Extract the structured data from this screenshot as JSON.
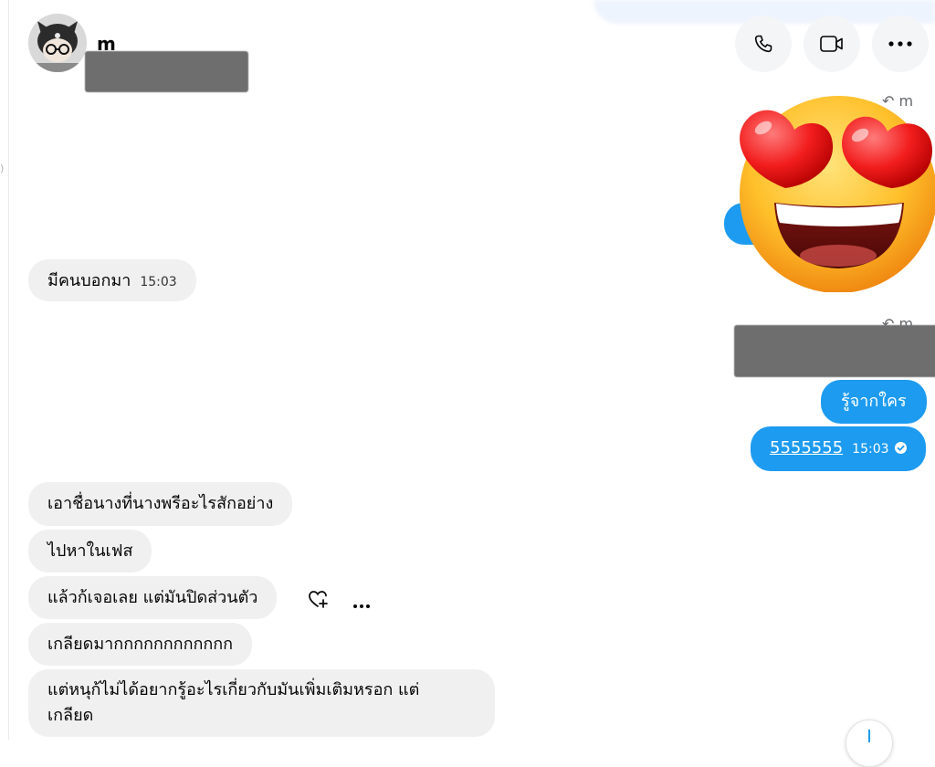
{
  "header": {
    "contact_name": "m",
    "call_label": "phone-icon",
    "video_label": "video-icon",
    "more_label": "more-icon"
  },
  "reply_hints": [
    "m",
    "m"
  ],
  "messages": {
    "in_1": {
      "text": "มีคนบอกมา",
      "time": "15:03"
    },
    "out_1": {
      "text": "รู้จากใคร"
    },
    "out_2": {
      "text": "5555555",
      "time": "15:03"
    },
    "in_2": {
      "text": "เอาชื่อนางที่นางพรีอะไรสักอย่าง"
    },
    "in_3": {
      "text": "ไปหาในเฟส"
    },
    "in_4": {
      "text": "แล้วก้เจอเลย แต่มันปิดส่วนตัว"
    },
    "in_5": {
      "text": "เกลียดมากกกกกกกกกกกก"
    },
    "in_6_line1": {
      "text": "แต่หนุก้ไม่ได้อยากรู้อะไรเกี่ยวกับมันเพิ่มเติมหรอก แต่"
    },
    "in_6_line2": {
      "text": "เกลียด"
    }
  },
  "colors": {
    "accent": "#1d9bf0",
    "incoming_bubble": "#f0f0f0"
  }
}
